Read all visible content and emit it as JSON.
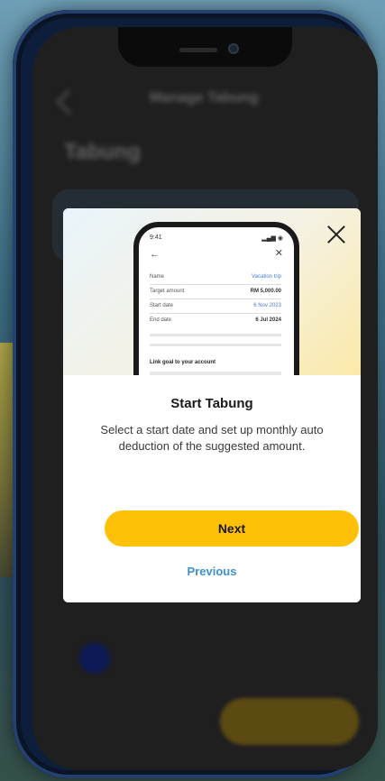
{
  "background_screen": {
    "header_title": "Manage Tabung",
    "heading": "Tabung",
    "subheading": "",
    "bottom_button_label": ""
  },
  "modal": {
    "illustration": {
      "status_time": "9:41",
      "status_icons": "▂▄▆ ◉",
      "rows": [
        {
          "label": "Name",
          "value": "Vacation trip",
          "accent": true
        },
        {
          "label": "Target amount",
          "value": "RM 5,000.00",
          "accent": false
        },
        {
          "label": "Start date",
          "value": "6 Nov 2023",
          "accent": true
        },
        {
          "label": "End date",
          "value": "6 Jul 2024",
          "accent": false
        }
      ],
      "link_title": "Link goal to your account"
    },
    "title": "Start Tabung",
    "description": "Select a start date and set up monthly auto deduction of the suggested amount.",
    "next_label": "Next",
    "previous_label": "Previous"
  },
  "colors": {
    "accent_yellow": "#ffc107",
    "link_blue": "#3d8fcf",
    "phone_frame": "#0d1e3a"
  }
}
